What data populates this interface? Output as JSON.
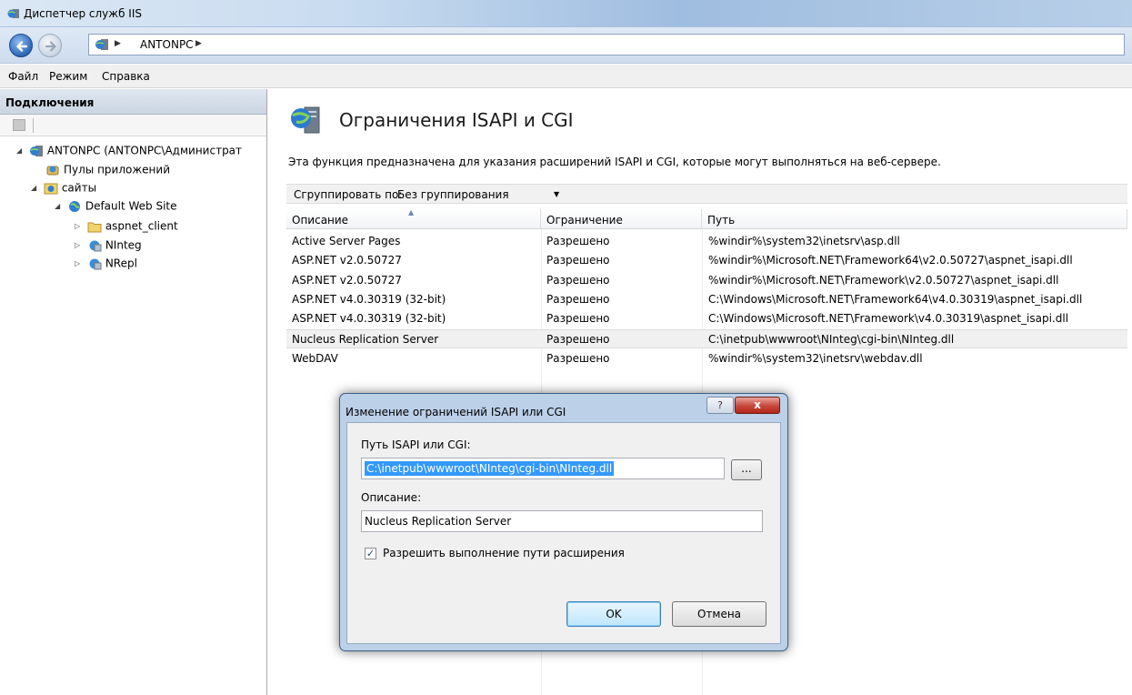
{
  "window": {
    "title": "Диспетчер служб IIS"
  },
  "address": {
    "crumb": "ANTONPC"
  },
  "menu": [
    "Файл",
    "Режим",
    "Справка"
  ],
  "connections": {
    "header": "Подключения",
    "tree": [
      {
        "label": "ANTONPC (ANTONPC\\Администрат",
        "icon": "server-icon"
      },
      {
        "label": "Пулы приложений",
        "icon": "app-pool-icon"
      },
      {
        "label": "сайты",
        "icon": "sites-folder-icon"
      },
      {
        "label": "Default Web Site",
        "icon": "globe-icon"
      },
      {
        "label": "aspnet_client",
        "icon": "folder-icon"
      },
      {
        "label": "NInteg",
        "icon": "application-icon"
      },
      {
        "label": "NRepl",
        "icon": "application-icon"
      }
    ]
  },
  "main": {
    "title": "Ограничения ISAPI и CGI",
    "description": "Эта функция предназначена для указания расширений ISAPI и CGI, которые могут выполняться на веб-сервере.",
    "group_label": "Сгруппировать по:",
    "group_value": "Без группирования",
    "columns": [
      "Описание",
      "Ограничение",
      "Путь"
    ],
    "rows": [
      [
        "Active Server Pages",
        "Разрешено",
        "%windir%\\system32\\inetsrv\\asp.dll"
      ],
      [
        "ASP.NET v2.0.50727",
        "Разрешено",
        "%windir%\\Microsoft.NET\\Framework64\\v2.0.50727\\aspnet_isapi.dll"
      ],
      [
        "ASP.NET v2.0.50727",
        "Разрешено",
        "%windir%\\Microsoft.NET\\Framework\\v2.0.50727\\aspnet_isapi.dll"
      ],
      [
        "ASP.NET v4.0.30319 (32-bit)",
        "Разрешено",
        "C:\\Windows\\Microsoft.NET\\Framework64\\v4.0.30319\\aspnet_isapi.dll"
      ],
      [
        "ASP.NET v4.0.30319 (32-bit)",
        "Разрешено",
        "C:\\Windows\\Microsoft.NET\\Framework\\v4.0.30319\\aspnet_isapi.dll"
      ],
      [
        "Nucleus Replication Server",
        "Разрешено",
        "C:\\inetpub\\wwwroot\\NInteg\\cgi-bin\\NInteg.dll"
      ],
      [
        "WebDAV",
        "Разрешено",
        "%windir%\\system32\\inetsrv\\webdav.dll"
      ]
    ]
  },
  "dialog": {
    "title": "Изменение ограничений ISAPI или CGI",
    "help": "?",
    "close": "x",
    "path_label": "Путь ISAPI или CGI:",
    "path_value": "C:\\inetpub\\wwwroot\\NInteg\\cgi-bin\\NInteg.dll",
    "browse": "...",
    "desc_label": "Описание:",
    "desc_value": "Nucleus Replication Server",
    "check_mark": "✓",
    "allow_label": "Разрешить выполнение пути расширения",
    "ok": "OK",
    "cancel": "Отмена"
  }
}
